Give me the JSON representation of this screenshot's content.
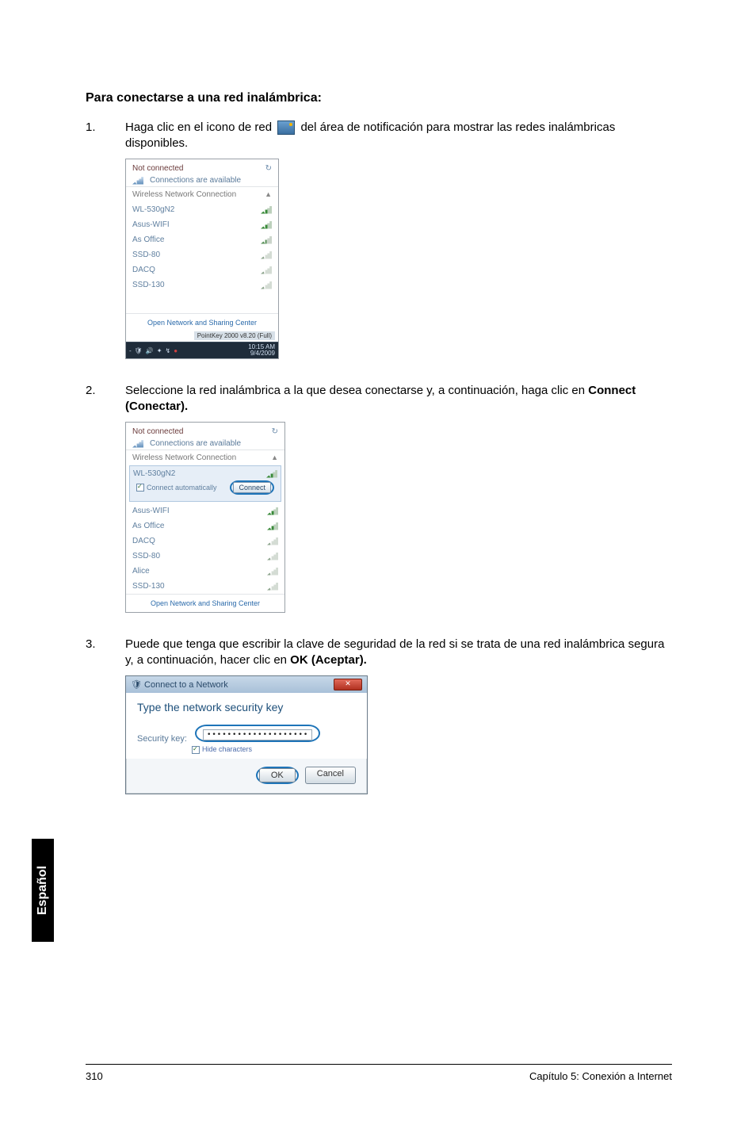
{
  "heading": "Para conectarse a una red inalámbrica:",
  "step1": {
    "num": "1.",
    "pre": "Haga clic en el icono de red ",
    "post": " del área de notificación para mostrar las redes inalámbricas disponibles."
  },
  "step2": {
    "num": "2.",
    "text_a": "Seleccione la red inalámbrica a la que desea conectarse y, a continuación, haga clic en ",
    "bold": "Connect (Conectar)."
  },
  "step3": {
    "num": "3.",
    "text_a": "Puede que tenga que escribir la clave de seguridad de la red si se trata de una red inalámbrica segura y, a continuación, hacer clic en ",
    "bold": "OK (Aceptar)."
  },
  "flyout1": {
    "header_title": "Not connected",
    "header_sub": "Connections are available",
    "section": "Wireless Network Connection",
    "networks": [
      "WL-530gN2",
      "Asus-WIFI",
      "As Office",
      "SSD-80",
      "DACQ",
      "SSD-130"
    ],
    "footer_link": "Open Network and Sharing Center",
    "tray_badge": "PointKey 2000 v8.20 (Full)",
    "tray_time": "10:15 AM",
    "tray_date": "9/4/2009"
  },
  "flyout2": {
    "header_title": "Not connected",
    "header_sub": "Connections are available",
    "section": "Wireless Network Connection",
    "selected": "WL-530gN2",
    "connect_auto": "Connect automatically",
    "connect_btn": "Connect",
    "networks": [
      "Asus-WIFI",
      "As Office",
      "DACQ",
      "SSD-80",
      "Alice",
      "SSD-130"
    ],
    "footer_link": "Open Network and Sharing Center"
  },
  "dialog": {
    "title": "Connect to a Network",
    "heading": "Type the network security key",
    "label": "Security key:",
    "value": "••••••••••••••••••••",
    "hide": "Hide characters",
    "ok": "OK",
    "cancel": "Cancel"
  },
  "lang_tab": "Español",
  "page_num": "310",
  "chapter": "Capítulo 5: Conexión a Internet"
}
